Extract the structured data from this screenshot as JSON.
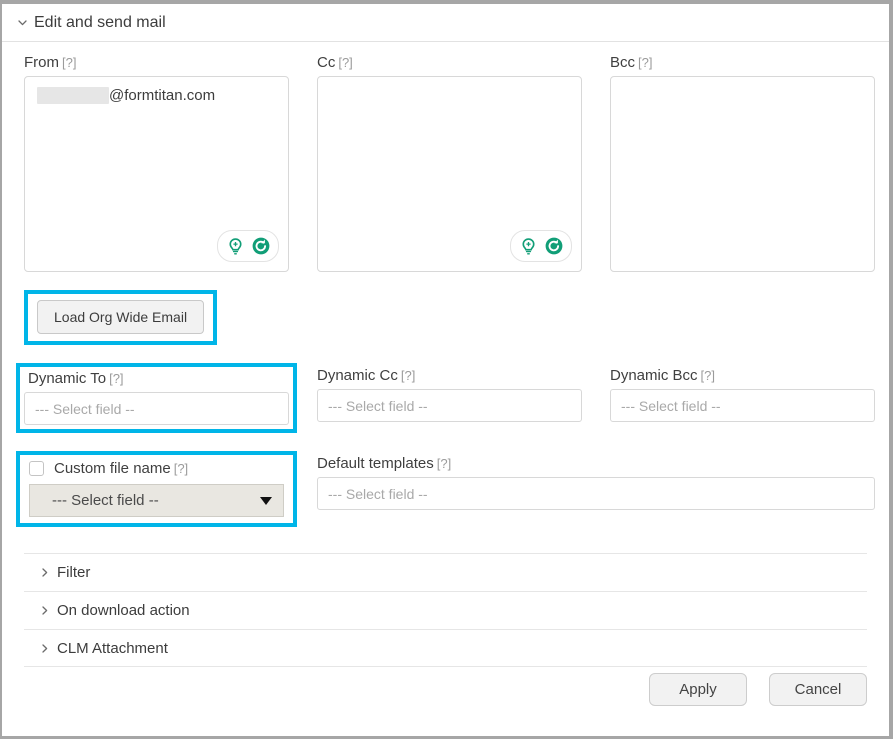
{
  "panel": {
    "title": "Edit and send mail",
    "expanded_icon": "chevron-down-icon"
  },
  "help_marker": "[?]",
  "recipients": {
    "from": {
      "label": "From",
      "help": "[?]",
      "value_suffix": "@formtitan.com",
      "value_redacted": true,
      "icons": [
        "lightbulb-plus-icon",
        "refresh-icon"
      ]
    },
    "cc": {
      "label": "Cc",
      "help": "[?]",
      "value_suffix": "",
      "value_redacted": false,
      "icons": [
        "lightbulb-plus-icon",
        "refresh-icon"
      ]
    },
    "bcc": {
      "label": "Bcc",
      "help": "[?]",
      "value_suffix": "",
      "value_redacted": false,
      "icons": []
    }
  },
  "load_org_button": {
    "label": "Load Org Wide Email",
    "highlighted": true
  },
  "dynamic": {
    "to": {
      "label": "Dynamic To",
      "help": "[?]",
      "placeholder": "--- Select field --",
      "highlighted": true
    },
    "cc": {
      "label": "Dynamic Cc",
      "help": "[?]",
      "placeholder": "--- Select field --",
      "highlighted": false
    },
    "bcc": {
      "label": "Dynamic Bcc",
      "help": "[?]",
      "placeholder": "--- Select field --",
      "highlighted": false
    }
  },
  "custom_file_name": {
    "label": "Custom file name",
    "help": "[?]",
    "checked": false,
    "select_value": "--- Select field --",
    "highlighted": true
  },
  "default_templates": {
    "label": "Default templates",
    "help": "[?]",
    "placeholder": "--- Select field --"
  },
  "accordion": [
    {
      "label": "Filter",
      "icon": "chevron-right-icon"
    },
    {
      "label": "On download action",
      "icon": "chevron-right-icon"
    },
    {
      "label": "CLM Attachment",
      "icon": "chevron-right-icon"
    }
  ],
  "footer": {
    "apply_label": "Apply",
    "cancel_label": "Cancel"
  },
  "colors": {
    "highlight": "#00b5e8",
    "icon_teal": "#119e77",
    "text": "#3c3c3c",
    "muted": "#a9a9a9"
  }
}
